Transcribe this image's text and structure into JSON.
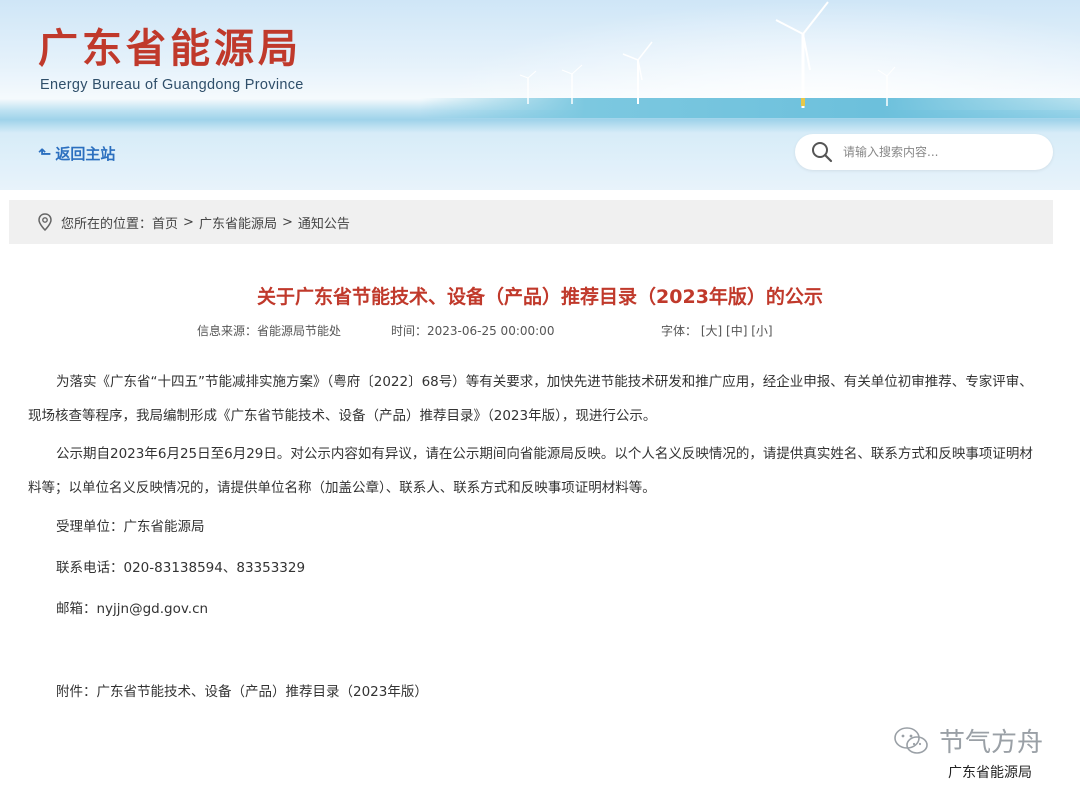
{
  "header": {
    "logo_cn": "广东省能源局",
    "logo_en": "Energy Bureau of Guangdong Province",
    "back_label": "返回主站",
    "search_placeholder": "请输入搜索内容..."
  },
  "breadcrumb": {
    "label": "您所在的位置：",
    "items": [
      "首页",
      "广东省能源局",
      "通知公告"
    ]
  },
  "article": {
    "title": "关于广东省节能技术、设备（产品）推荐目录（2023年版）的公示",
    "source": "信息来源：省能源局节能处",
    "time": "时间：2023-06-25 00:00:00",
    "font_label": "字体：",
    "font_options": [
      "[大]",
      "[中]",
      "[小]"
    ],
    "paragraph1": "为落实《广东省“十四五”节能减排实施方案》（粤府〔2022〕68号）等有关要求，加快先进节能技术研发和推广应用，经企业申报、有关单位初审推荐、专家评审、现场核查等程序，我局编制形成《广东省节能技术、设备（产品）推荐目录》（2023年版），现进行公示。",
    "paragraph2": "公示期自2023年6月25日至6月29日。对公示内容如有异议，请在公示期间向省能源局反映。以个人名义反映情况的，请提供真实姓名、联系方式和反映事项证明材料等；以单位名义反映情况的，请提供单位名称（加盖公章）、联系人、联系方式和反映事项证明材料等。",
    "accept_unit": "受理单位：广东省能源局",
    "phone": "联系电话：020-83138594、83353329",
    "email": "邮箱：nyjjn@gd.gov.cn",
    "attachment": "附件：广东省节能技术、设备（产品）推荐目录（2023年版）"
  },
  "watermark": {
    "channel": "节气方舟",
    "source": "广东省能源局"
  },
  "colors": {
    "title_red": "#c0392b",
    "link_blue": "#2b6fbf"
  }
}
